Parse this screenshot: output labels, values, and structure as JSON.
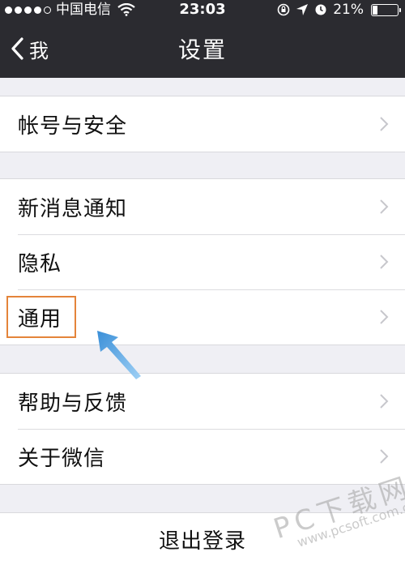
{
  "status_bar": {
    "carrier": "中国电信",
    "time": "23:03",
    "battery_percent": "21%",
    "battery_level": 0.21,
    "signal_bars_filled": 4,
    "signal_bars_total": 5
  },
  "navbar": {
    "back_label": "我",
    "title": "设置"
  },
  "groups": [
    {
      "items": [
        "帐号与安全"
      ]
    },
    {
      "items": [
        "新消息通知",
        "隐私",
        "通用"
      ]
    },
    {
      "items": [
        "帮助与反馈",
        "关于微信"
      ]
    }
  ],
  "logout_label": "退出登录",
  "watermark": {
    "brand": "PC下载网",
    "url": "www.pcsoft.com.cn"
  },
  "colors": {
    "nav_background": "#2b2b30",
    "page_background": "#efeff4",
    "highlight_box": "#e4843a",
    "annotation_arrow": "#3a8fd8"
  },
  "icons": [
    "wifi-icon",
    "rotation-lock-icon",
    "location-arrow-icon",
    "alarm-icon",
    "battery-icon",
    "back-chevron-icon",
    "chevron-right-icon"
  ]
}
